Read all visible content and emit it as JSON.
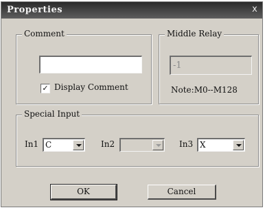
{
  "window": {
    "title": "Properties",
    "close_glyph": "x"
  },
  "comment_group": {
    "label": "Comment",
    "input_value": "",
    "display_checkbox": {
      "checked": true,
      "check_glyph": "✓",
      "label": "Display Comment"
    }
  },
  "middle_relay_group": {
    "label": "Middle Relay",
    "input_value": "-1",
    "note": "Note:M0--M128"
  },
  "special_input_group": {
    "label": "Special Input",
    "inputs": [
      {
        "label": "In1",
        "value": "C",
        "enabled": true
      },
      {
        "label": "In2",
        "value": "",
        "enabled": false
      },
      {
        "label": "In3",
        "value": "X",
        "enabled": true
      }
    ]
  },
  "buttons": {
    "ok": "OK",
    "cancel": "Cancel"
  },
  "colors": {
    "face": "#d4d0c8",
    "titlebar": "#2a2a2a",
    "title_text": "#f2f2f2"
  }
}
